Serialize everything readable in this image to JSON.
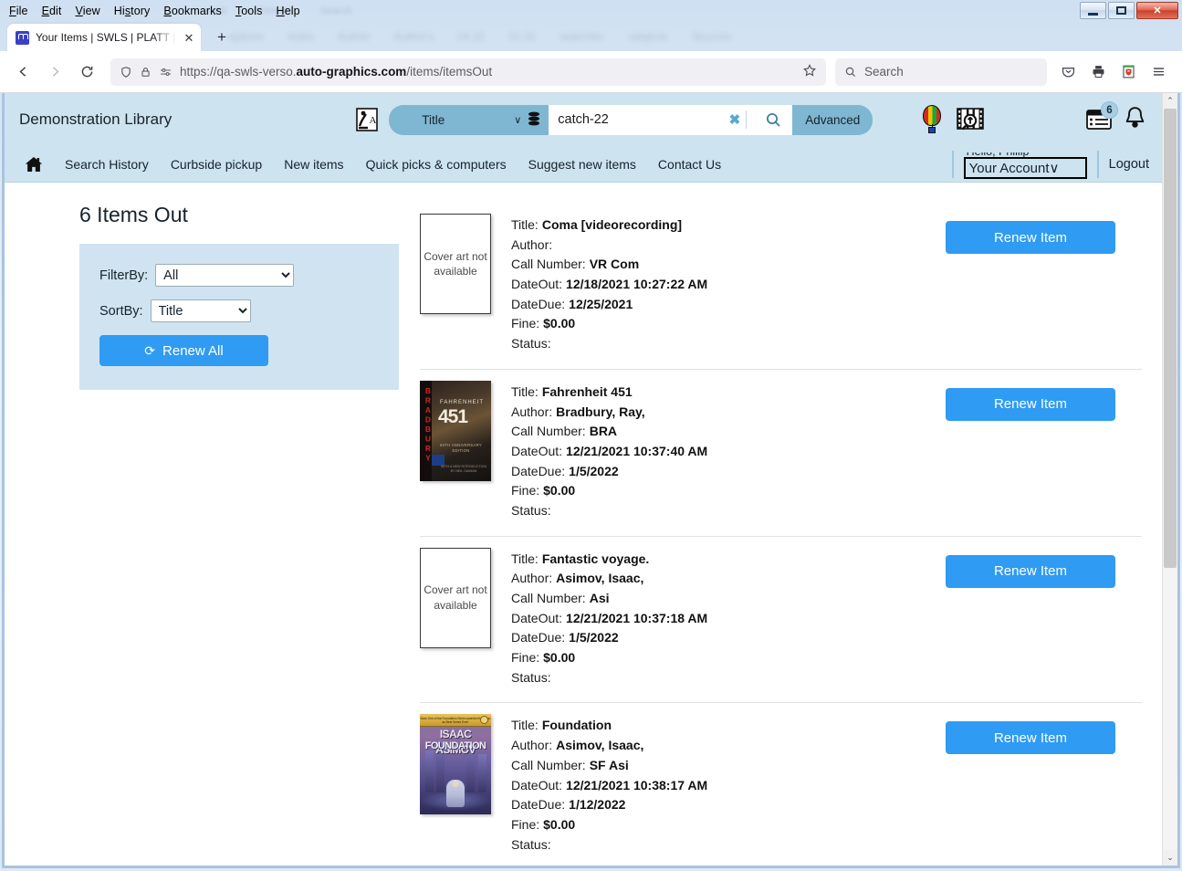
{
  "browser": {
    "menus": [
      "File",
      "Edit",
      "View",
      "History",
      "Bookmarks",
      "Tools",
      "Help"
    ],
    "tab": {
      "title": "Your Items | SWLS | PLATT | Aut",
      "favicon": "library-logo-icon",
      "close_label": "✕",
      "new_tab_label": "+"
    },
    "window_controls": {
      "minimize": "minimize-button",
      "restore": "restore-button",
      "close": "✕"
    },
    "nav": {
      "back": "←",
      "forward": "→",
      "reload": "↻"
    },
    "url": {
      "prefix": "https://qa-swls-verso.",
      "host": "auto-graphics.com",
      "suffix": "/items/itemsOut",
      "shield_icon": "shield-icon",
      "lock_icon": "lock-icon",
      "permissions_icon": "permissions-icon",
      "bookmark_icon": "star-icon"
    },
    "search": {
      "placeholder": "Search",
      "icon": "search-icon"
    },
    "toolbar_icons": [
      "pocket-icon",
      "print-icon",
      "adblock-icon",
      "hamburger-menu-icon"
    ]
  },
  "site": {
    "library_name": "Demonstration Library",
    "search_type_icon": "search-scope-icon",
    "search_type_value": "Title",
    "search_type_chevron": "∨",
    "database_icon": "database-icon",
    "search_value": "catch-22",
    "search_clear": "✖",
    "search_go_icon": "magnifier-icon",
    "advanced_label": "Advanced",
    "icons": {
      "balloon": "hot-air-balloon-icon",
      "film_search": "film-search-icon",
      "list_badge": "my-lists-icon",
      "list_badge_count": "6",
      "bell": "notification-bell-icon"
    },
    "nav_links": [
      "Search History",
      "Curbside pickup",
      "New items",
      "Quick picks & computers",
      "Suggest new items",
      "Contact Us"
    ],
    "home_icon": "home-icon",
    "account": {
      "greeting": "Hello, Phillip",
      "button_label": "Your Account",
      "button_chevron": "∨",
      "logout_label": "Logout"
    }
  },
  "main": {
    "page_title": "6 Items Out",
    "filter": {
      "filter_by_label": "FilterBy:",
      "filter_by_value": "All",
      "sort_by_label": "SortBy:",
      "sort_by_value": "Title",
      "renew_all_label": "Renew All",
      "renew_all_icon": "refresh-icon"
    },
    "labels": {
      "title": "Title:",
      "author": "Author:",
      "call_number": "Call Number:",
      "date_out": "DateOut:",
      "date_due": "DateDue:",
      "fine": "Fine:",
      "status": "Status:"
    },
    "renew_item_label": "Renew Item",
    "no_cover_text": "Cover art not available",
    "items": [
      {
        "cover": "none",
        "title": "Coma [videorecording]",
        "author": "",
        "call_number": "VR Com",
        "date_out": "12/18/2021 10:27:22 AM",
        "date_due": "12/25/2021",
        "fine": "$0.00",
        "status": ""
      },
      {
        "cover": "fahrenheit451",
        "cover_art": {
          "spine": "BRADBURY",
          "top": "FAHRENHEIT",
          "number": "451",
          "sub": "60TH ANNIVERSARY EDITION",
          "sub2": "WITH A NEW INTRODUCTION BY NEIL GAIMAN"
        },
        "title": "Fahrenheit 451",
        "author": "Bradbury, Ray,",
        "call_number": "BRA",
        "date_out": "12/21/2021 10:37:40 AM",
        "date_due": "1/5/2022",
        "fine": "$0.00",
        "status": ""
      },
      {
        "cover": "none",
        "title": "Fantastic voyage.",
        "author": "Asimov, Isaac,",
        "call_number": "Asi",
        "date_out": "12/21/2021 10:37:18 AM",
        "date_due": "1/5/2022",
        "fine": "$0.00",
        "status": ""
      },
      {
        "cover": "foundation",
        "cover_art": {
          "band": "Book One of the Foundation Series awarded the Hugo as Best Series Ever!",
          "author_art": "ISAAC ASIMOV",
          "title_art": "FOUNDATION"
        },
        "title": "Foundation",
        "author": "Asimov, Isaac,",
        "call_number": "SF Asi",
        "date_out": "12/21/2021 10:38:17 AM",
        "date_due": "1/12/2022",
        "fine": "$0.00",
        "status": ""
      }
    ]
  },
  "scrollbar": {
    "up_arrow": "⌃",
    "down_arrow": "⌄"
  },
  "colors": {
    "header_bg": "#cde3ef",
    "accent_blue": "#2f9bf2",
    "search_pill": "#7fb6d2",
    "panel_bg": "#cfe4f0"
  }
}
